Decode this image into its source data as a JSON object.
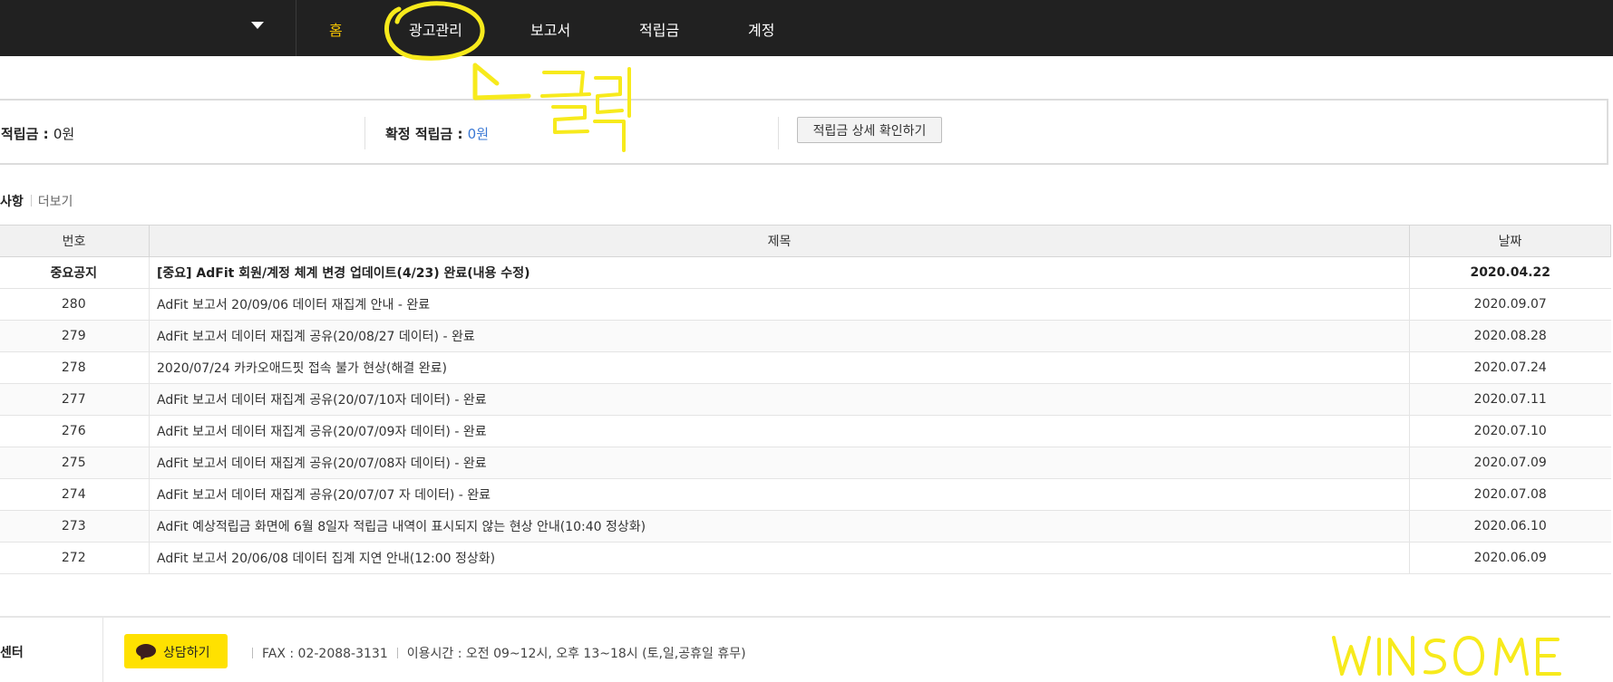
{
  "nav": {
    "items": [
      {
        "label": "홈",
        "active": true
      },
      {
        "label": "광고관리",
        "active": false
      },
      {
        "label": "보고서",
        "active": false
      },
      {
        "label": "적립금",
        "active": false
      },
      {
        "label": "계정",
        "active": false
      }
    ]
  },
  "points": {
    "expected_label": "적립금 : ",
    "expected_value": "0원",
    "confirmed_label": "확정 적립금 : ",
    "confirmed_value": "0원",
    "detail_button": "적립금 상세 확인하기"
  },
  "notices": {
    "title": "사항",
    "more": "더보기",
    "columns": [
      "번호",
      "제목",
      "날짜"
    ],
    "rows": [
      {
        "num": "중요공지",
        "title": "[중요] AdFit 회원/계정 체계 변경 업데이트(4/23) 완료(내용 수정)",
        "date": "2020.04.22",
        "important": true
      },
      {
        "num": "280",
        "title": "AdFit 보고서 20/09/06 데이터 재집계 안내 - 완료",
        "date": "2020.09.07"
      },
      {
        "num": "279",
        "title": "AdFit 보고서 데이터 재집계 공유(20/08/27 데이터) - 완료",
        "date": "2020.08.28"
      },
      {
        "num": "278",
        "title": "2020/07/24 카카오애드핏 접속 불가 현상(해결 완료)",
        "date": "2020.07.24"
      },
      {
        "num": "277",
        "title": "AdFit 보고서 데이터 재집계 공유(20/07/10자 데이터) - 완료",
        "date": "2020.07.11"
      },
      {
        "num": "276",
        "title": "AdFit 보고서 데이터 재집계 공유(20/07/09자 데이터) - 완료",
        "date": "2020.07.10"
      },
      {
        "num": "275",
        "title": "AdFit 보고서 데이터 재집계 공유(20/07/08자 데이터) - 완료",
        "date": "2020.07.09"
      },
      {
        "num": "274",
        "title": "AdFit 보고서 데이터 재집계 공유(20/07/07 자 데이터) - 완료",
        "date": "2020.07.08"
      },
      {
        "num": "273",
        "title": "AdFit 예상적립금 화면에 6월 8일자 적립금 내역이 표시되지 않는 현상 안내(10:40 정상화)",
        "date": "2020.06.10"
      },
      {
        "num": "272",
        "title": "AdFit 보고서 20/06/08 데이터 집계 지연 안내(12:00 정상화)",
        "date": "2020.06.09"
      }
    ]
  },
  "footer": {
    "section_label": "센터",
    "chat_button": "상담하기",
    "fax": "FAX : 02-2088-3131",
    "hours": "이용시간 : 오전 09~12시, 오후 13~18시 (토,일,공휴일 휴무)"
  },
  "annotations": {
    "click_note": "클릭",
    "signature": "WINSOME",
    "color": "#f7ea1c"
  },
  "colors": {
    "nav_bg": "#212121",
    "nav_active": "#f5c400",
    "link_blue": "#3a78d4",
    "chat_yellow": "#ffe100"
  }
}
